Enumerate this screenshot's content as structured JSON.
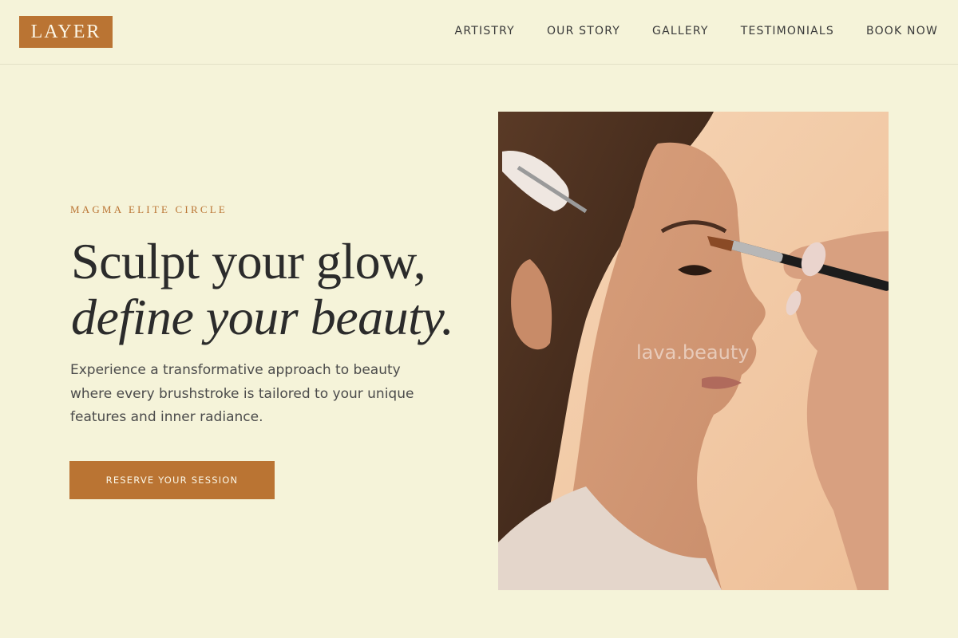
{
  "brand": {
    "logo": "LAYER",
    "accent_color": "#ba7433",
    "background_color": "#f5f3d9"
  },
  "nav": {
    "items": [
      {
        "label": "ARTISTRY"
      },
      {
        "label": "OUR STORY"
      },
      {
        "label": "GALLERY"
      },
      {
        "label": "TESTIMONIALS"
      },
      {
        "label": "BOOK NOW"
      }
    ]
  },
  "hero": {
    "eyebrow": "MAGMA ELITE CIRCLE",
    "headline_line1": "Sculpt your glow,",
    "headline_line2": "define your beauty.",
    "description": "Experience a transformative approach to beauty where every brushstroke is tailored to your unique features and inner radiance.",
    "cta_label": "RESERVE YOUR SESSION"
  },
  "photo": {
    "watermark": "lava.beauty",
    "subject": "model-receiving-eye-makeup"
  }
}
